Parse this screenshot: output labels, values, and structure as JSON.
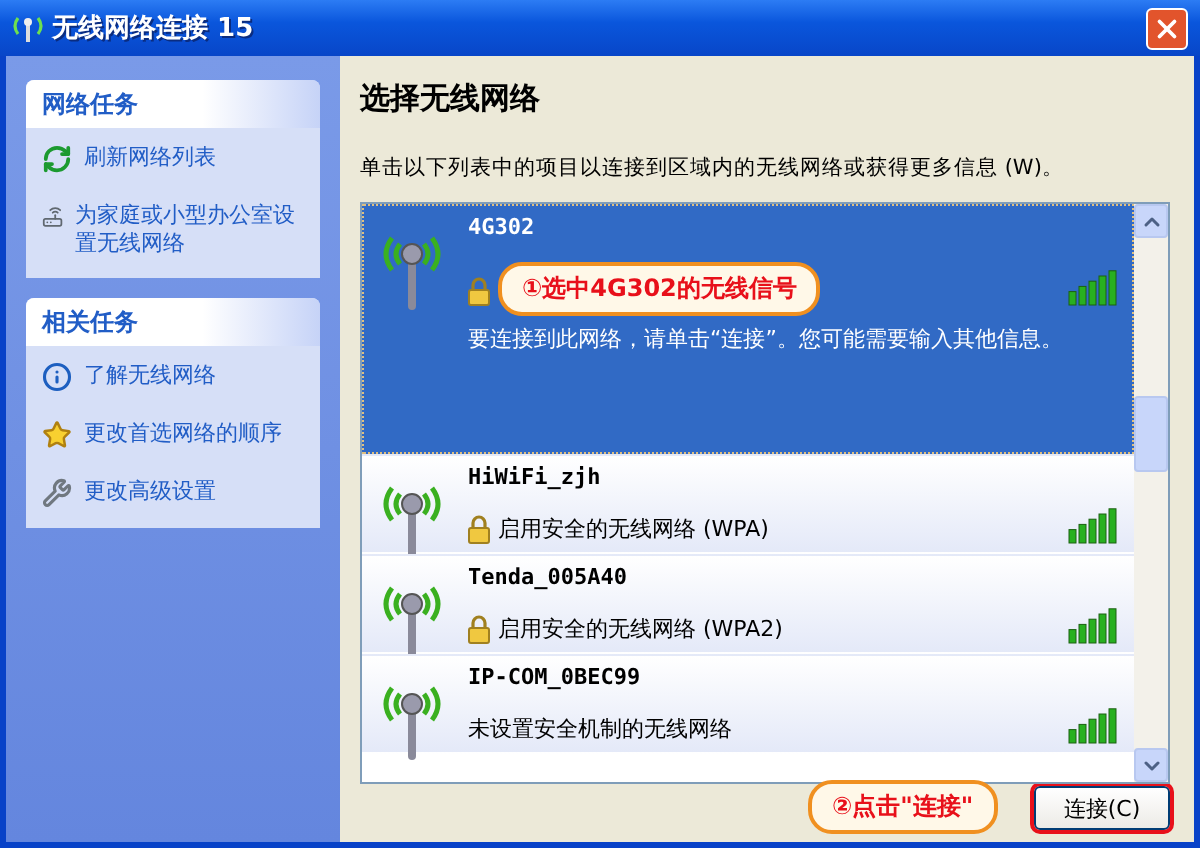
{
  "window": {
    "title": "无线网络连接 15"
  },
  "sidebar": {
    "panels": [
      {
        "title": "网络任务",
        "items": [
          {
            "kind": "refresh",
            "label": "刷新网络列表"
          },
          {
            "kind": "setup",
            "label": "为家庭或小型办公室设置无线网络"
          }
        ]
      },
      {
        "title": "相关任务",
        "items": [
          {
            "kind": "info",
            "label": "了解无线网络"
          },
          {
            "kind": "star",
            "label": "更改首选网络的顺序"
          },
          {
            "kind": "wrench",
            "label": "更改高级设置"
          }
        ]
      }
    ]
  },
  "heading": "选择无线网络",
  "instruction": "单击以下列表中的项目以连接到区域内的无线网络或获得更多信息 (W)。",
  "networks": [
    {
      "name": "4G302",
      "secured": true,
      "selected": true,
      "hint": "要连接到此网络，请单击“连接”。您可能需要输入其他信息。"
    },
    {
      "name": "HiWiFi_zjh",
      "secured": true,
      "selected": false,
      "status": "启用安全的无线网络 (WPA)"
    },
    {
      "name": "Tenda_005A40",
      "secured": true,
      "selected": false,
      "status": "启用安全的无线网络 (WPA2)"
    },
    {
      "name": "IP-COM_0BEC99",
      "secured": false,
      "selected": false,
      "status": "未设置安全机制的无线网络"
    }
  ],
  "callouts": [
    "①选中4G302的无线信号",
    "②点击\"连接\""
  ],
  "connect_button": {
    "label": "连接(C)",
    "highlighted": true
  }
}
